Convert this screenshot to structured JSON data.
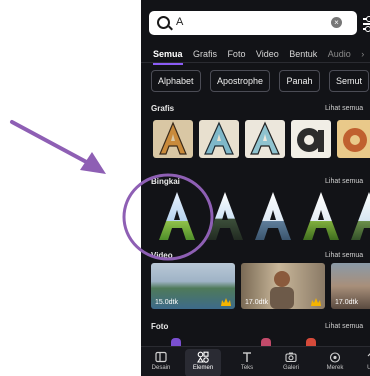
{
  "search": {
    "query": "A"
  },
  "tabs": [
    "Semua",
    "Grafis",
    "Foto",
    "Video",
    "Bentuk",
    "Audio"
  ],
  "chips": [
    "Alphabet",
    "Apostrophe",
    "Panah",
    "Semut"
  ],
  "sections": {
    "grafis": {
      "title": "Grafis",
      "see_all": "Lihat semua"
    },
    "bingkai": {
      "title": "Bingkai",
      "see_all": "Lihat semua"
    },
    "video": {
      "title": "Video",
      "see_all": "Lihat semua"
    },
    "foto": {
      "title": "Foto",
      "see_all": "Lihat semua"
    }
  },
  "videos": [
    {
      "duration": "15.0dtk"
    },
    {
      "duration": "17.0dtk"
    },
    {
      "duration": "17.0dtk"
    }
  ],
  "nav": [
    "Desain",
    "Elemen",
    "Teks",
    "Galeri",
    "Merek",
    "Un"
  ],
  "colors": {
    "accent": "#8b5cf6",
    "annotation": "#8e5fb4",
    "background": "#121317"
  }
}
